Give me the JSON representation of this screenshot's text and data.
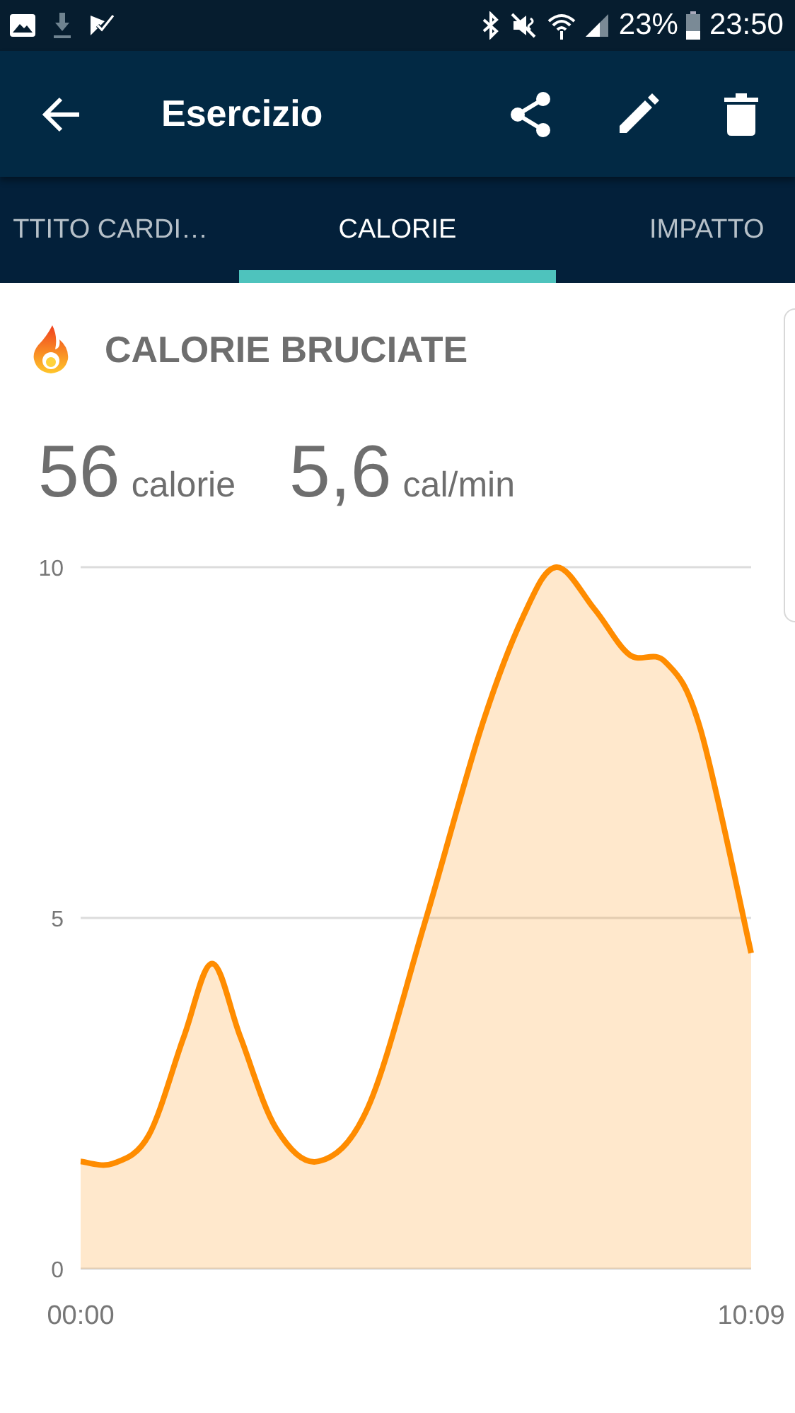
{
  "status_bar": {
    "battery": "23%",
    "time": "23:50"
  },
  "app_bar": {
    "title": "Esercizio"
  },
  "tabs": [
    {
      "label": "TTITO CARDI…",
      "selected": false
    },
    {
      "label": "CALORIE",
      "selected": true
    },
    {
      "label": "IMPATTO",
      "selected": false
    }
  ],
  "card": {
    "title": "CALORIE BRUCIATE",
    "stats": [
      {
        "value": "56",
        "unit": "calorie"
      },
      {
        "value": "5,6",
        "unit": "cal/min"
      }
    ],
    "chart_data": {
      "type": "area",
      "x": [
        0,
        0.49,
        1.03,
        1.56,
        1.99,
        2.42,
        2.96,
        3.6,
        4.35,
        5.2,
        6.06,
        6.7,
        7.2,
        7.78,
        8.31,
        8.85,
        9.38,
        10.15
      ],
      "series": [
        {
          "color": "#ff8c00",
          "values": [
            1.53,
            1.5,
            1.9,
            3.3,
            4.35,
            3.3,
            2.0,
            1.53,
            2.3,
            4.9,
            7.7,
            9.3,
            10,
            9.4,
            8.75,
            8.65,
            7.7,
            4.5
          ]
        }
      ],
      "xlim": [
        0,
        10.15
      ],
      "ylim": [
        0,
        10
      ],
      "xticks": [
        {
          "value": 0,
          "label": "00:00"
        },
        {
          "value": 10.15,
          "label": "10:09"
        }
      ],
      "yticks": [
        {
          "value": 0,
          "label": "0"
        },
        {
          "value": 5,
          "label": "5"
        },
        {
          "value": 10,
          "label": "10"
        }
      ]
    }
  }
}
